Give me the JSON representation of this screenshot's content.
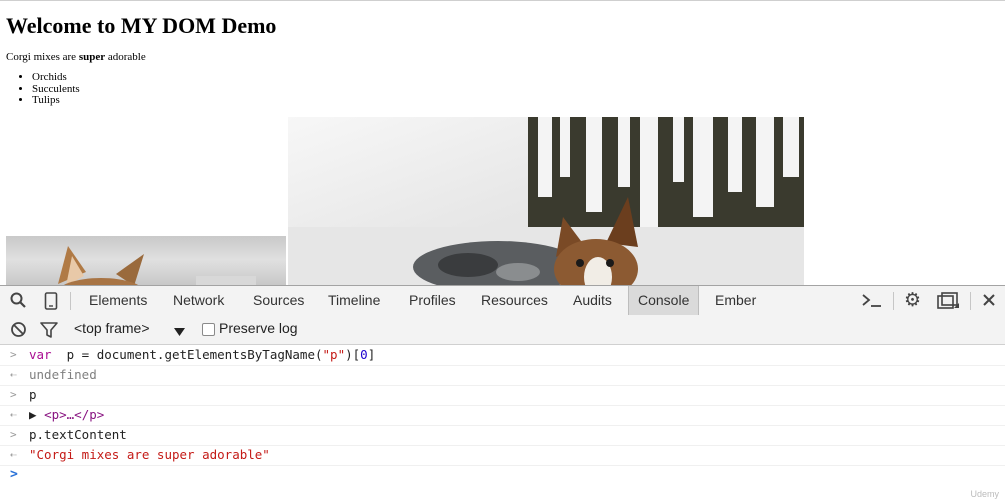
{
  "page": {
    "heading": "Welcome to MY DOM Demo",
    "paragraph_before": "Corgi mixes are ",
    "paragraph_bold": "super",
    "paragraph_after": " adorable",
    "list": [
      "Orchids",
      "Succulents",
      "Tulips"
    ]
  },
  "devtools": {
    "tabs": [
      "Elements",
      "Network",
      "Sources",
      "Timeline",
      "Profiles",
      "Resources",
      "Audits",
      "Console",
      "Ember"
    ],
    "active_tab": "Console",
    "frame_select": "<top frame>",
    "preserve_log_label": "Preserve log",
    "console_lines": [
      {
        "type": "input",
        "parts": [
          [
            "kw",
            "var"
          ],
          [
            "",
            "  p = document.getElementsByTagName("
          ],
          [
            "str",
            "\"p\""
          ],
          [
            "",
            ")["
          ],
          [
            "num",
            "0"
          ],
          [
            "",
            "]"
          ]
        ]
      },
      {
        "type": "output",
        "parts": [
          [
            "undef",
            "undefined"
          ]
        ]
      },
      {
        "type": "input",
        "parts": [
          [
            "",
            "p"
          ]
        ]
      },
      {
        "type": "output",
        "parts": [
          [
            "",
            "▶ "
          ],
          [
            "tag",
            "<p>…</p>"
          ]
        ]
      },
      {
        "type": "input",
        "parts": [
          [
            "",
            "p.textContent"
          ]
        ]
      },
      {
        "type": "output",
        "parts": [
          [
            "str",
            "\"Corgi mixes are super adorable\""
          ]
        ]
      }
    ]
  },
  "watermark": "Udemy",
  "colors": {
    "active_tab_bg": "#dadada",
    "string": "#c41a16",
    "keyword": "#aa0d91",
    "prompt": "#2a72d8"
  }
}
